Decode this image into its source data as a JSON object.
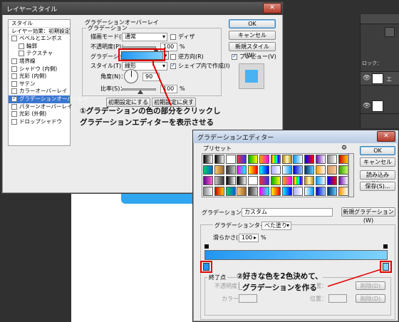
{
  "colors": {
    "gradient_start": "#2196f3",
    "gradient_end": "#7fd3ff",
    "annotation_red": "#e00000",
    "selection": "#3a76d0"
  },
  "layer_style": {
    "title": "レイヤースタイル",
    "styles_header": "スタイル",
    "blend_defaults": "レイヤー効果：初期設定",
    "items": [
      {
        "label": "ベベルとエンボス",
        "checked": false,
        "indent": false,
        "selected": false
      },
      {
        "label": "輪郭",
        "checked": false,
        "indent": true,
        "selected": false
      },
      {
        "label": "テクスチャ",
        "checked": false,
        "indent": true,
        "selected": false
      },
      {
        "label": "境界線",
        "checked": false,
        "indent": false,
        "selected": false
      },
      {
        "label": "シャドウ (内側)",
        "checked": false,
        "indent": false,
        "selected": false
      },
      {
        "label": "光彩 (内側)",
        "checked": false,
        "indent": false,
        "selected": false
      },
      {
        "label": "サテン",
        "checked": false,
        "indent": false,
        "selected": false
      },
      {
        "label": "カラーオーバーレイ",
        "checked": false,
        "indent": false,
        "selected": false
      },
      {
        "label": "グラデーションオーバーレイ",
        "checked": true,
        "indent": false,
        "selected": true
      },
      {
        "label": "パターンオーバーレイ",
        "checked": false,
        "indent": false,
        "selected": false
      },
      {
        "label": "光彩 (外側)",
        "checked": false,
        "indent": false,
        "selected": false
      },
      {
        "label": "ドロップシャドウ",
        "checked": false,
        "indent": false,
        "selected": false
      }
    ],
    "section_title": "グラデーションオーバーレイ",
    "subsection_title": "グラデーション",
    "blend_mode_label": "描画モード(B)：",
    "blend_mode_value": "通常",
    "dither_label": "ディザ",
    "opacity_label": "不透明度(P)：",
    "opacity_value": "100",
    "percent": "%",
    "gradient_label": "グラデーション：",
    "reverse_label": "逆方向(R)",
    "style_label": "スタイル(T)：",
    "style_value": "線形",
    "align_label": "シェイプ内で作成(I)",
    "angle_label": "角度(N)：",
    "angle_value": "90",
    "scale_label": "比率(S)：",
    "scale_value": "100",
    "reset_button": "初期設定にする",
    "restore_button": "初期設定に戻す",
    "ok_button": "OK",
    "cancel_button": "キャンセル",
    "new_style_button": "新規スタイル(W)...",
    "preview_label": "プレビュー(V)"
  },
  "grad_editor": {
    "title": "グラデーションエディター",
    "presets_label": "プリセット",
    "ok_button": "OK",
    "cancel_button": "キャンセル",
    "load_button": "読み込み(L)...",
    "save_button": "保存(S)...",
    "name_label": "グラデーション名(N)：",
    "name_value": "カスタム",
    "new_gradient_button": "新規グラデーション(W)",
    "type_label": "グラデーションタイプ(T)：",
    "type_value": "べた塗り",
    "smooth_label": "滑らかさ(M)：",
    "smooth_value": "100",
    "percent": "%",
    "stops_label": "終了点",
    "opacity_field_label": "不透明度：",
    "color_field_label": "カラー：",
    "position_label": "位置：",
    "position_label2": "位置：",
    "delete_button": "削除(D)",
    "delete_button2": "削除(D)"
  },
  "annotations": {
    "note1_line1": "①グラデーションの色の部分をクリックし",
    "note1_line2": "グラデーションエディターを表示させる",
    "note2_line1": "②好きな色を2色決めて、",
    "note2_line2": "グラデーションを作る"
  },
  "background": {
    "panel_text_1": "ロック：",
    "panel_text_2": "エ"
  }
}
